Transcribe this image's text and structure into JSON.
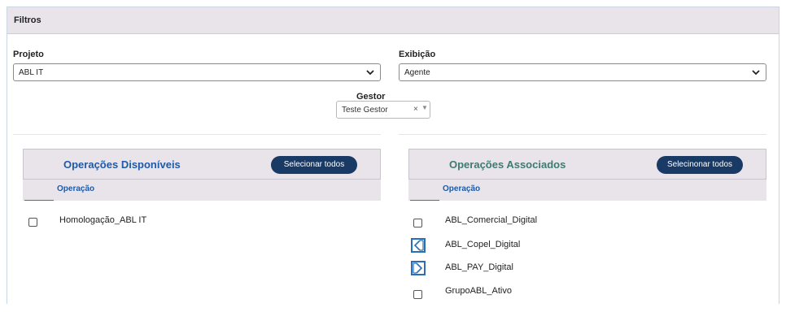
{
  "filters": {
    "title": "Filtros",
    "projeto": {
      "label": "Projeto",
      "value": "ABL IT"
    },
    "exibicao": {
      "label": "Exibição",
      "value": "Agente"
    },
    "gestor": {
      "label": "Gestor",
      "value": "Teste Gestor",
      "clear": "×",
      "arrow": "▼"
    }
  },
  "available": {
    "title": "Operações Disponíveis",
    "select_all": "Selecionar todos",
    "column": "Operação",
    "items": [
      "Homologação_ABL IT"
    ]
  },
  "associated": {
    "title": "Operações Associados",
    "select_all": "Selecinonar todos",
    "column": "Operação",
    "items": [
      "ABL_Comercial_Digital",
      "ABL_Copel_Digital",
      "ABL_PAY_Digital",
      "GrupoABL_Ativo"
    ]
  },
  "colors": {
    "accent": "#1a3a66",
    "link_blue": "#1e5aa8",
    "title_green": "#3e7a72",
    "header_bg": "#e8e4ea"
  },
  "icons": {
    "move_left": "move-left-icon",
    "move_right": "move-right-icon",
    "chevron": "chevron-down-icon"
  }
}
